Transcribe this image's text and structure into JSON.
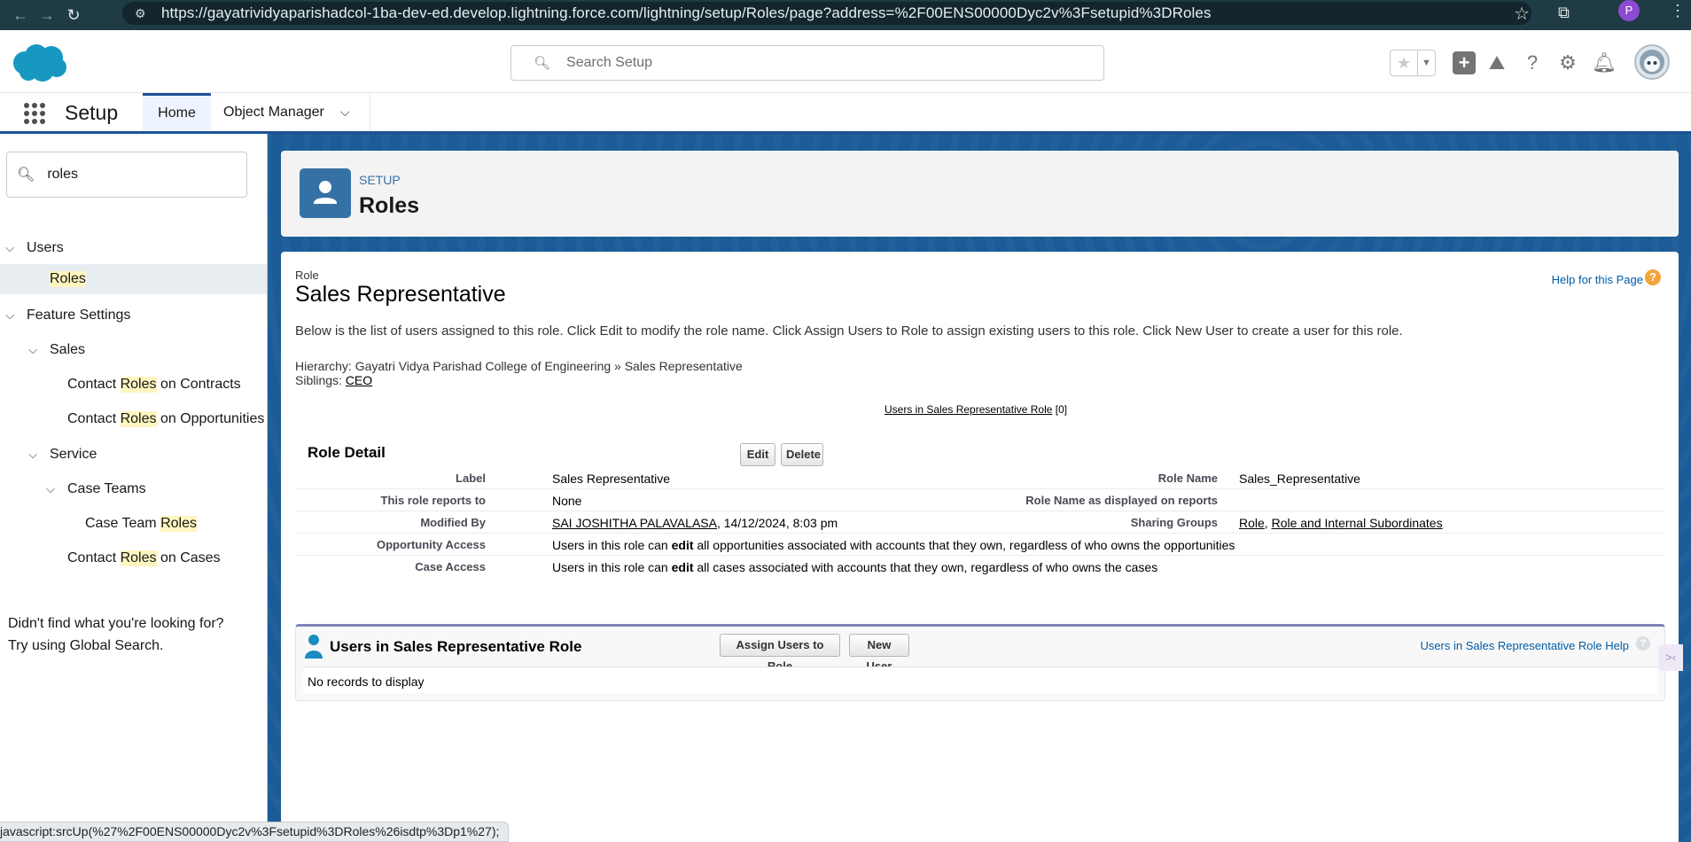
{
  "browser": {
    "url": "https://gayatrividyaparishadcol-1ba-dev-ed.develop.lightning.force.com/lightning/setup/Roles/page?address=%2F00ENS00000Dyc2v%3Fsetupid%3DRoles",
    "profile_initial": "P",
    "status_text": "javascript:srcUp(%27%2F00ENS00000Dyc2v%3Fsetupid%3DRoles%26isdtp%3Dp1%27);"
  },
  "header": {
    "search_placeholder": "Search Setup"
  },
  "app_nav": {
    "app_name": "Setup",
    "tabs": [
      {
        "label": "Home"
      },
      {
        "label": "Object Manager"
      }
    ]
  },
  "sidebar": {
    "search_value": "roles",
    "items": [
      {
        "label": "Users"
      },
      {
        "label": "Roles"
      },
      {
        "label": "Feature Settings"
      },
      {
        "label": "Sales"
      },
      {
        "prefix": "Contact ",
        "highlight": "Roles",
        "suffix": " on Contracts"
      },
      {
        "prefix": "Contact ",
        "highlight": "Roles",
        "suffix": " on Opportunities"
      },
      {
        "label": "Service"
      },
      {
        "label": "Case Teams"
      },
      {
        "prefix": "Case Team ",
        "highlight": "Roles",
        "suffix": ""
      },
      {
        "prefix": "Contact ",
        "highlight": "Roles",
        "suffix": " on Cases"
      }
    ],
    "note_line1": "Didn't find what you're looking for?",
    "note_line2": "Try using Global Search."
  },
  "page_header": {
    "eyebrow": "SETUP",
    "title": "Roles"
  },
  "role": {
    "kicker": "Role",
    "title": "Sales Representative",
    "help_link": "Help for this Page",
    "description": "Below is the list of users assigned to this role. Click Edit to modify the role name. Click Assign Users to Role to assign existing users to this role. Click New User to create a user for this role.",
    "hierarchy_prefix": "Hierarchy: ",
    "hierarchy_value": "Gayatri Vidya Parishad College of Engineering » Sales Representative",
    "siblings_prefix": "Siblings: ",
    "siblings_value": "CEO",
    "users_link": "Users in Sales Representative Role",
    "users_count": "[0]"
  },
  "detail": {
    "title": "Role Detail",
    "edit": "Edit",
    "delete": "Delete",
    "label_label": "Label",
    "label_value": "Sales Representative",
    "role_name_label": "Role Name",
    "role_name_value": "Sales_Representative",
    "reports_to_label": "This role reports to",
    "reports_to_value": "None",
    "displayed_label": "Role Name as displayed on reports",
    "modified_label": "Modified By",
    "modified_user": "SAI JOSHITHA PALAVALASA",
    "modified_date": ", 14/12/2024, 8:03 pm",
    "sharing_label": "Sharing Groups",
    "sharing_role": "Role",
    "sharing_sep": ", ",
    "sharing_internal": "Role and Internal Subordinates",
    "opp_label": "Opportunity Access",
    "opp_pre": "Users in this role can ",
    "opp_bold": "edit",
    "opp_post": " all opportunities associated with accounts that they own, regardless of who owns the opportunities",
    "case_label": "Case Access",
    "case_pre": "Users in this role can ",
    "case_bold": "edit",
    "case_post": " all cases associated with accounts that they own, regardless of who owns the cases"
  },
  "related": {
    "title": "Users in Sales Representative Role",
    "assign": "Assign Users to Role",
    "new_user": "New User",
    "help": "Users in Sales Representative Role Help",
    "empty": "No records to display"
  },
  "colors": {
    "brand_blue": "#1b5297",
    "link_blue": "#015ba7",
    "highlight": "#fff5c0"
  }
}
